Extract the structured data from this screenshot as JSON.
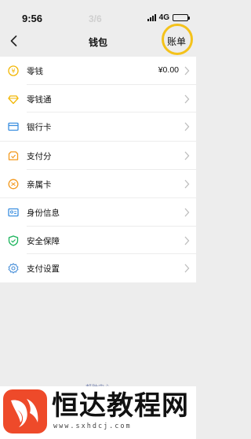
{
  "status_bar": {
    "time": "9:56",
    "page_indicator": "3/6",
    "network": "4G"
  },
  "nav": {
    "title": "钱包",
    "bill_label": "账单"
  },
  "sections": [
    {
      "items": [
        {
          "label": "零钱",
          "value": "¥0.00",
          "icon": "coin-icon"
        },
        {
          "label": "零钱通",
          "value": "",
          "icon": "diamond-icon"
        },
        {
          "label": "银行卡",
          "value": "",
          "icon": "bank-card-icon"
        }
      ]
    },
    {
      "items": [
        {
          "label": "支付分",
          "value": "",
          "icon": "pay-score-icon"
        },
        {
          "label": "亲属卡",
          "value": "",
          "icon": "family-card-icon"
        }
      ]
    },
    {
      "items": [
        {
          "label": "身份信息",
          "value": "",
          "icon": "id-card-icon"
        },
        {
          "label": "安全保障",
          "value": "",
          "icon": "shield-check-icon"
        },
        {
          "label": "支付设置",
          "value": "",
          "icon": "settings-gear-icon"
        }
      ]
    }
  ],
  "footer": {
    "help_link": "帮助中心"
  },
  "watermark": {
    "site_name": "恒达教程网",
    "url": "www.sxhdcj.com"
  },
  "colors": {
    "background": "#ededed",
    "highlight_ring": "#f4c21b",
    "coin_yellow": "#f2b705",
    "bank_blue": "#3b8fe0",
    "pay_score_orange": "#f39a1f",
    "security_green": "#19b35a",
    "settings_blue": "#4a90d9"
  }
}
